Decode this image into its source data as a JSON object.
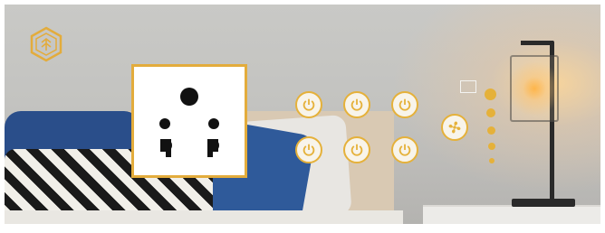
{
  "logo": {
    "icon": "hexagon-logo-icon"
  },
  "socket": {
    "icon": "power-socket-icon"
  },
  "switches": [
    {
      "id": "switch-1",
      "icon": "power-icon"
    },
    {
      "id": "switch-2",
      "icon": "power-icon"
    },
    {
      "id": "switch-3",
      "icon": "power-icon"
    },
    {
      "id": "switch-4",
      "icon": "power-icon"
    },
    {
      "id": "switch-5",
      "icon": "power-icon"
    },
    {
      "id": "switch-6",
      "icon": "power-icon"
    }
  ],
  "fan": {
    "icon": "fan-icon",
    "speed_levels": 5,
    "active_level": 1
  },
  "colors": {
    "accent": "#e5b13a",
    "panel_bg": "#ffffff",
    "button_bg": "#f8f4ea"
  }
}
